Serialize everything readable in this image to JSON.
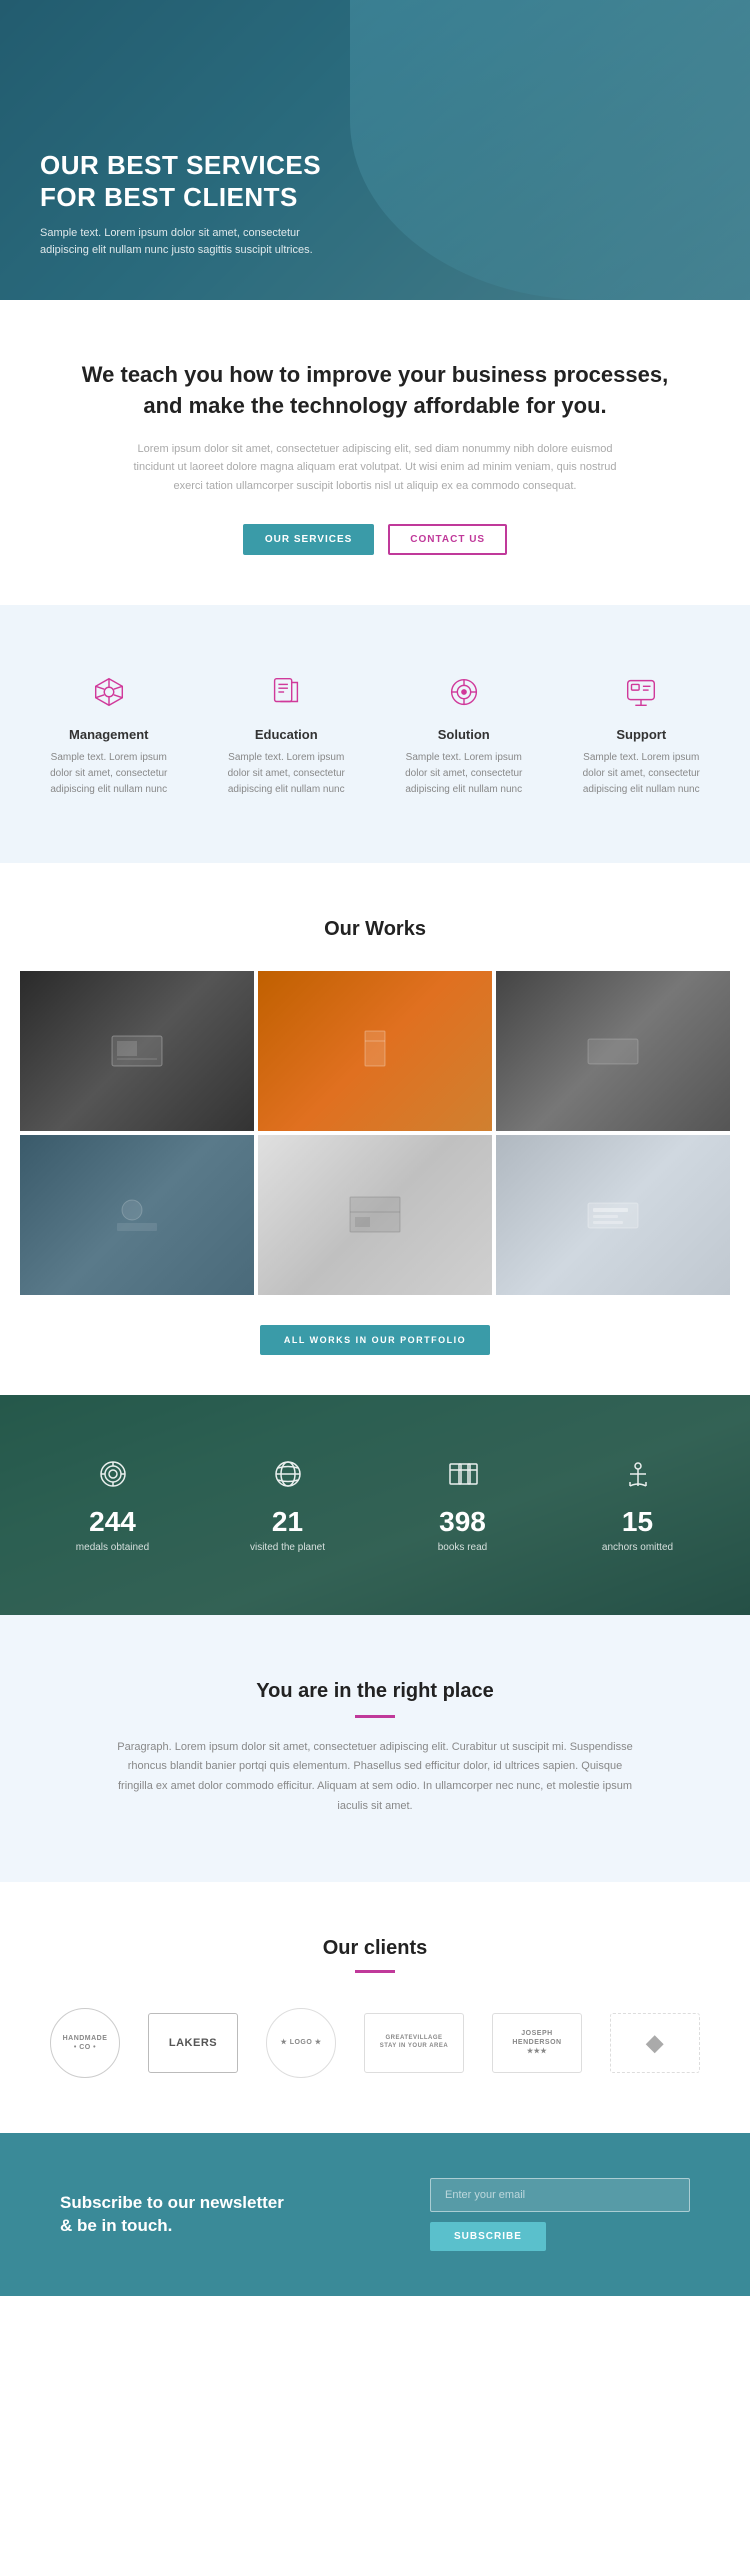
{
  "hero": {
    "title": "OUR BEST SERVICES\nFOR BEST CLIENTS",
    "subtitle": "Sample text. Lorem ipsum dolor sit amet, consectetur adipiscing elit nullam nunc justo sagittis suscipit ultrices."
  },
  "intro": {
    "heading": "We teach you how to improve your business processes,\nand make the technology affordable for you.",
    "body": "Lorem ipsum dolor sit amet, consectetuer adipiscing elit, sed diam nonummy nibh dolore euismod tincidunt ut laoreet dolore magna aliquam erat volutpat. Ut wisi enim ad minim veniam, quis nostrud exerci tation ullamcorper suscipit lobortis nisl ut aliquip ex ea commodo consequat.",
    "btn_services": "OUR SERVICES",
    "btn_contact": "CONTACT US"
  },
  "features": [
    {
      "id": "management",
      "title": "Management",
      "desc": "Sample text. Lorem ipsum dolor sit amet, consectetur adipiscing elit nullam nunc"
    },
    {
      "id": "education",
      "title": "Education",
      "desc": "Sample text. Lorem ipsum dolor sit amet, consectetur adipiscing elit nullam nunc"
    },
    {
      "id": "solution",
      "title": "Solution",
      "desc": "Sample text. Lorem ipsum dolor sit amet, consectetur adipiscing elit nullam nunc"
    },
    {
      "id": "support",
      "title": "Support",
      "desc": "Sample text. Lorem ipsum dolor sit amet, consectetur adipiscing elit nullam nunc"
    }
  ],
  "works": {
    "section_title": "Our Works",
    "btn_label": "ALL WORKS IN OUR PORTFOLIO"
  },
  "stats": [
    {
      "number": "244",
      "label": "medals obtained",
      "icon": "⚙"
    },
    {
      "number": "21",
      "label": "visited the planet",
      "icon": "🌐"
    },
    {
      "number": "398",
      "label": "books read",
      "icon": "📚"
    },
    {
      "number": "15",
      "label": "anchors omitted",
      "icon": "⚓"
    }
  ],
  "right_place": {
    "title": "You are in the right place",
    "body": "Paragraph. Lorem ipsum dolor sit amet, consectetuer adipiscing elit. Curabitur ut suscipit mi. Suspendisse rhoncus blandit banier portqi quis elementum. Phasellus sed efficitur dolor, id ultrices sapien. Quisque fringilla ex amet dolor commodo efficitur. Aliquam at sem odio. In ullamcorper nec nunc, et molestie ipsum iaculis sit amet."
  },
  "clients": {
    "title": "Our clients",
    "logos": [
      "HANDMADE\n• CO •",
      "LAKERS",
      "★ LOGO ★",
      "GREATEVILLAGE\nSTAY IN YOUR AREA",
      "Joseph\nHENDERSON\n★★★",
      "◆"
    ]
  },
  "newsletter": {
    "text": "Subscribe to our newsletter\n& be in touch.",
    "input_placeholder": "Enter your email",
    "btn_label": "SUBSCRIBE"
  }
}
